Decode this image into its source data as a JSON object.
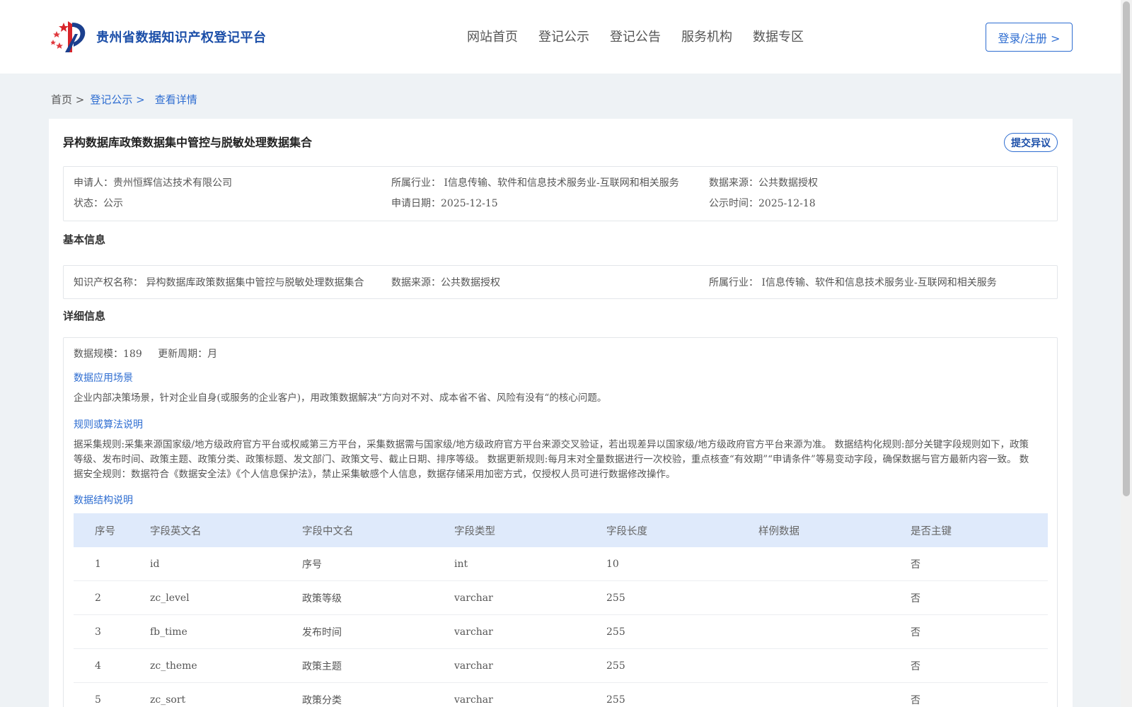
{
  "header": {
    "platform_name": "贵州省数据知识产权登记平台",
    "nav": [
      "网站首页",
      "登记公示",
      "登记公告",
      "服务机构",
      "数据专区"
    ],
    "login_label": "登录/注册 >"
  },
  "breadcrumb": {
    "home": "首页 >",
    "list": "登记公示 >",
    "current": "查看详情"
  },
  "record": {
    "title": "异构数据库政策数据集中管控与脱敏处理数据集合",
    "objection_label": "提交异议",
    "applicant": "申请人：贵州恒辉信达技术有限公司",
    "industry": "所属行业：  I信息传输、软件和信息技术服务业-互联网和相关服务",
    "source": "数据来源：公共数据授权",
    "status": "状态：公示",
    "apply_date": "申请日期：2025-12-15",
    "publish_date": "公示时间：2025-12-18"
  },
  "basic": {
    "section_title": "基本信息",
    "ip_name": "知识产权名称：  异构数据库政策数据集中管控与脱敏处理数据集合",
    "source": "数据来源：公共数据授权",
    "industry": "所属行业：  I信息传输、软件和信息技术服务业-互联网和相关服务"
  },
  "detail": {
    "section_title": "详细信息",
    "scale": "数据规模：189",
    "cycle": "更新周期：月",
    "scenario_title": "数据应用场景",
    "scenario_text": "企业内部决策场景，针对企业自身(或服务的企业客户)，用政策数据解决“方向对不对、成本省不省、风险有没有“的核心问题。",
    "rule_title": "规则或算法说明",
    "rule_text": "据采集规则:采集来源国家级/地方级政府官方平台或权威第三方平台，采集数据需与国家级/地方级政府官方平台来源交叉验证，若出现差异以国家级/地方级政府官方平台来源为准。 数据结构化规则:部分关键字段规则如下，政策等级、发布时间、政策主题、政策分类、政策标题、发文部门、政策文号、截止日期、排序等级。 数据更新规则:每月末对全量数据进行一次校验，重点核查“有效期”“申请条件”等易变动字段，确保数据与官方最新内容一致。 数据安全规则：数据符合《数据安全法》《个人信息保护法》，禁止采集敏感个人信息，数据存储采用加密方式，仅授权人员可进行数据修改操作。",
    "structure_title": "数据结构说明",
    "table": {
      "headers": [
        "序号",
        "字段英文名",
        "字段中文名",
        "字段类型",
        "字段长度",
        "样例数据",
        "是否主键"
      ],
      "rows": [
        [
          "1",
          "id",
          "序号",
          "int",
          "10",
          "",
          "否"
        ],
        [
          "2",
          "zc_level",
          "政策等级",
          "varchar",
          "255",
          "",
          "否"
        ],
        [
          "3",
          "fb_time",
          "发布时间",
          "varchar",
          "255",
          "",
          "否"
        ],
        [
          "4",
          "zc_theme",
          "政策主题",
          "varchar",
          "255",
          "",
          "否"
        ],
        [
          "5",
          "zc_sort",
          "政策分类",
          "varchar",
          "255",
          "",
          "否"
        ]
      ]
    }
  },
  "colors": {
    "brand": "#1b4ea8",
    "link": "#2e6dd1",
    "table_header_bg": "#dfeafb",
    "page_bg": "#eef2f5"
  }
}
